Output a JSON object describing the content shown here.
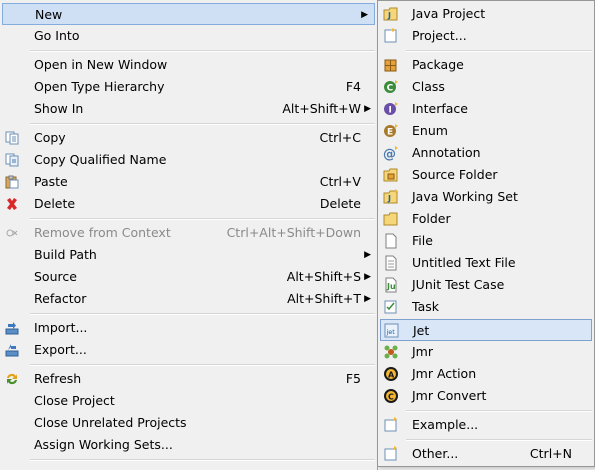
{
  "main_menu": {
    "items": [
      {
        "label": "New",
        "shortcut": "",
        "submenu": true
      },
      {
        "label": "Go Into",
        "shortcut": ""
      },
      {
        "label": "Open in New Window",
        "shortcut": ""
      },
      {
        "label": "Open Type Hierarchy",
        "shortcut": "F4"
      },
      {
        "label": "Show In",
        "shortcut": "Alt+Shift+W",
        "submenu": true
      },
      {
        "label": "Copy",
        "shortcut": "Ctrl+C",
        "icon": "copy-icon"
      },
      {
        "label": "Copy Qualified Name",
        "shortcut": "",
        "icon": "copy-qualified-name-icon"
      },
      {
        "label": "Paste",
        "shortcut": "Ctrl+V",
        "icon": "paste-icon"
      },
      {
        "label": "Delete",
        "shortcut": "Delete",
        "icon": "delete-icon"
      },
      {
        "label": "Remove from Context",
        "shortcut": "Ctrl+Alt+Shift+Down",
        "disabled": true,
        "icon": "remove-context-icon"
      },
      {
        "label": "Build Path",
        "shortcut": "",
        "submenu": true
      },
      {
        "label": "Source",
        "shortcut": "Alt+Shift+S",
        "submenu": true
      },
      {
        "label": "Refactor",
        "shortcut": "Alt+Shift+T",
        "submenu": true
      },
      {
        "label": "Import...",
        "shortcut": "",
        "icon": "import-icon"
      },
      {
        "label": "Export...",
        "shortcut": "",
        "icon": "export-icon"
      },
      {
        "label": "Refresh",
        "shortcut": "F5",
        "icon": "refresh-icon"
      },
      {
        "label": "Close Project",
        "shortcut": ""
      },
      {
        "label": "Close Unrelated Projects",
        "shortcut": ""
      },
      {
        "label": "Assign Working Sets...",
        "shortcut": ""
      }
    ]
  },
  "sub_menu": {
    "items": [
      {
        "label": "Java Project",
        "icon": "java-project-icon"
      },
      {
        "label": "Project...",
        "icon": "project-icon"
      },
      {
        "label": "Package",
        "icon": "package-icon"
      },
      {
        "label": "Class",
        "icon": "class-icon"
      },
      {
        "label": "Interface",
        "icon": "interface-icon"
      },
      {
        "label": "Enum",
        "icon": "enum-icon"
      },
      {
        "label": "Annotation",
        "icon": "annotation-icon"
      },
      {
        "label": "Source Folder",
        "icon": "source-folder-icon"
      },
      {
        "label": "Java Working Set",
        "icon": "java-working-set-icon"
      },
      {
        "label": "Folder",
        "icon": "folder-icon"
      },
      {
        "label": "File",
        "icon": "file-icon"
      },
      {
        "label": "Untitled Text File",
        "icon": "untitled-text-file-icon"
      },
      {
        "label": "JUnit Test Case",
        "icon": "junit-test-case-icon"
      },
      {
        "label": "Task",
        "icon": "task-icon"
      },
      {
        "label": "Jet",
        "icon": "jet-icon"
      },
      {
        "label": "Jmr",
        "icon": "jmr-icon"
      },
      {
        "label": "Jmr Action",
        "icon": "jmr-action-icon"
      },
      {
        "label": "Jmr Convert",
        "icon": "jmr-convert-icon"
      },
      {
        "label": "Example...",
        "icon": "example-icon"
      },
      {
        "label": "Other...",
        "shortcut": "Ctrl+N",
        "icon": "other-icon"
      }
    ]
  },
  "colors": {
    "menu_bg": "#f0f0f0",
    "highlight_bg": "#d8e6f7",
    "highlight_border": "#7da2ce",
    "disabled_text": "#8a8a8a"
  }
}
